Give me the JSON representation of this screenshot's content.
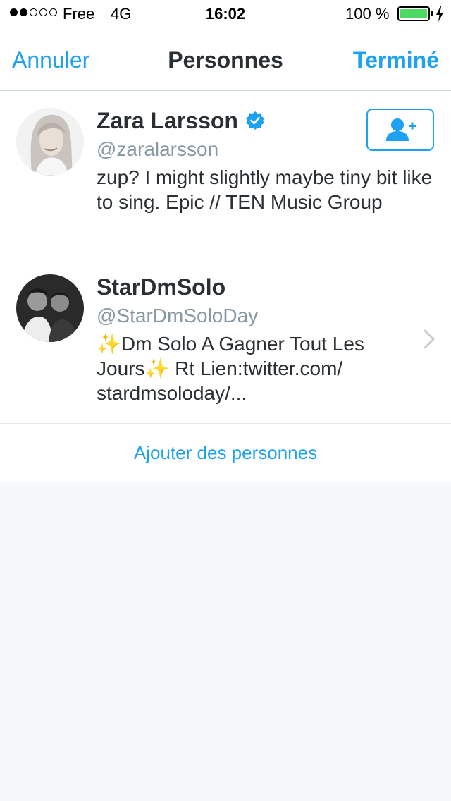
{
  "status_bar": {
    "carrier": "Free",
    "network": "4G",
    "time": "16:02",
    "battery_percent": "100 %",
    "signal_bars_filled": 2,
    "signal_bars_total": 5
  },
  "nav": {
    "cancel_label": "Annuler",
    "title": "Personnes",
    "done_label": "Terminé"
  },
  "people": [
    {
      "name": "Zara Larsson",
      "handle": "@zaralarsson",
      "verified": true,
      "bio": "zup? I might slightly maybe tiny bit like to sing. Epic // TEN Music Group",
      "action_icon": "add-user-icon"
    },
    {
      "name": "StarDmSolo",
      "handle": "@StarDmSoloDay",
      "verified": false,
      "bio": "✨Dm Solo A Gagner Tout Les Jours✨ Rt Lien:twitter.com/ stardmsoloday/...",
      "action_icon": "chevron-right-icon"
    }
  ],
  "add_people_label": "Ajouter des personnes",
  "colors": {
    "accent": "#1DA1F2",
    "battery": "#4CD964",
    "background": "#F5F8FA"
  }
}
